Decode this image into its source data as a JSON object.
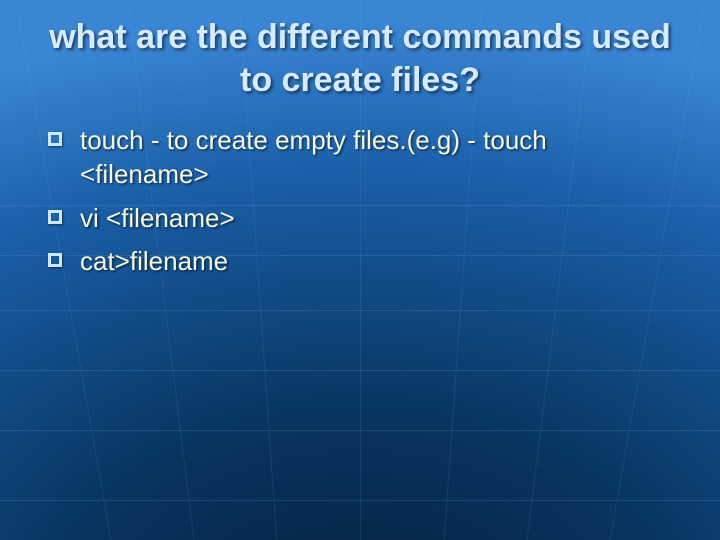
{
  "title": "what are the different commands used to create files?",
  "bullets": [
    "touch - to create empty files.(e.g) - touch <filename>",
    "vi <filename>",
    "cat>filename"
  ]
}
